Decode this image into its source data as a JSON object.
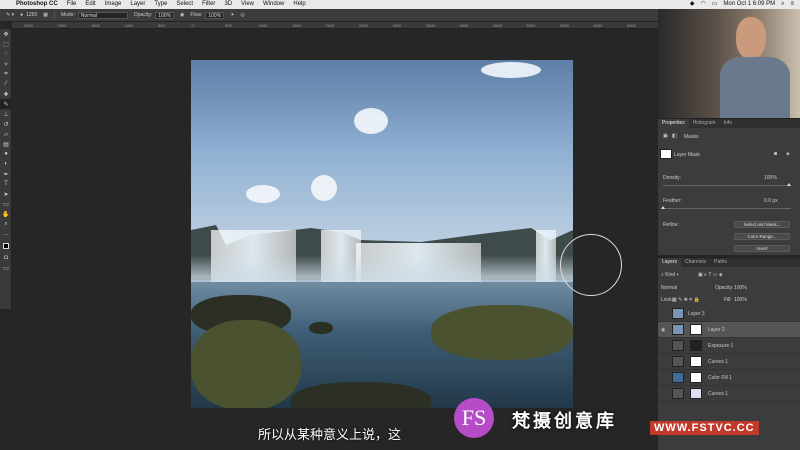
{
  "menubar": {
    "app": "Photoshop CC",
    "items": [
      "File",
      "Edit",
      "Image",
      "Layer",
      "Type",
      "Select",
      "Filter",
      "3D",
      "View",
      "Window",
      "Help"
    ],
    "clock": "Mon Oct 1  6:09 PM"
  },
  "options": {
    "size": "1250",
    "mode_label": "Mode:",
    "mode_value": "Normal",
    "opacity_label": "Opacity:",
    "opacity_value": "100%",
    "flow_label": "Flow:",
    "flow_value": "100%"
  },
  "ruler": [
    "2000",
    "2500",
    "1500",
    "1000",
    "500",
    "0",
    "500",
    "1000",
    "1500",
    "2000",
    "2500",
    "3000",
    "3500",
    "4000",
    "4500",
    "5000",
    "5500",
    "6000",
    "6500"
  ],
  "properties": {
    "tabs": [
      "Properties",
      "Histogram",
      "Info"
    ],
    "masks_label": "Masks",
    "layer_mask_label": "Layer Mask",
    "density_label": "Density:",
    "density_value": "100%",
    "feather_label": "Feather:",
    "feather_value": "0.0 px",
    "refine_label": "Refine:",
    "select_mask_button": "Select and Mask...",
    "color_range_button": "Color Range...",
    "invert_button": "Invert"
  },
  "layers": {
    "tabs": [
      "Layers",
      "Channels",
      "Paths"
    ],
    "kind": "Kind",
    "blend_mode": "Normal",
    "opacity_label": "Opacity:",
    "opacity_value": "100%",
    "lock_label": "Lock:",
    "fill_label": "Fill:",
    "fill_value": "100%",
    "items": [
      {
        "name": "Layer 3"
      },
      {
        "name": "Layer 2"
      },
      {
        "name": "Exposure 1"
      },
      {
        "name": "Curves 1"
      },
      {
        "name": "Color Fill 1"
      },
      {
        "name": "Curves 1"
      }
    ]
  },
  "subtitle": "所以从某种意义上说，这",
  "watermark": {
    "mark": "FS",
    "text": "梵摄创意库",
    "url": "WWW.FSTVC.CC"
  }
}
